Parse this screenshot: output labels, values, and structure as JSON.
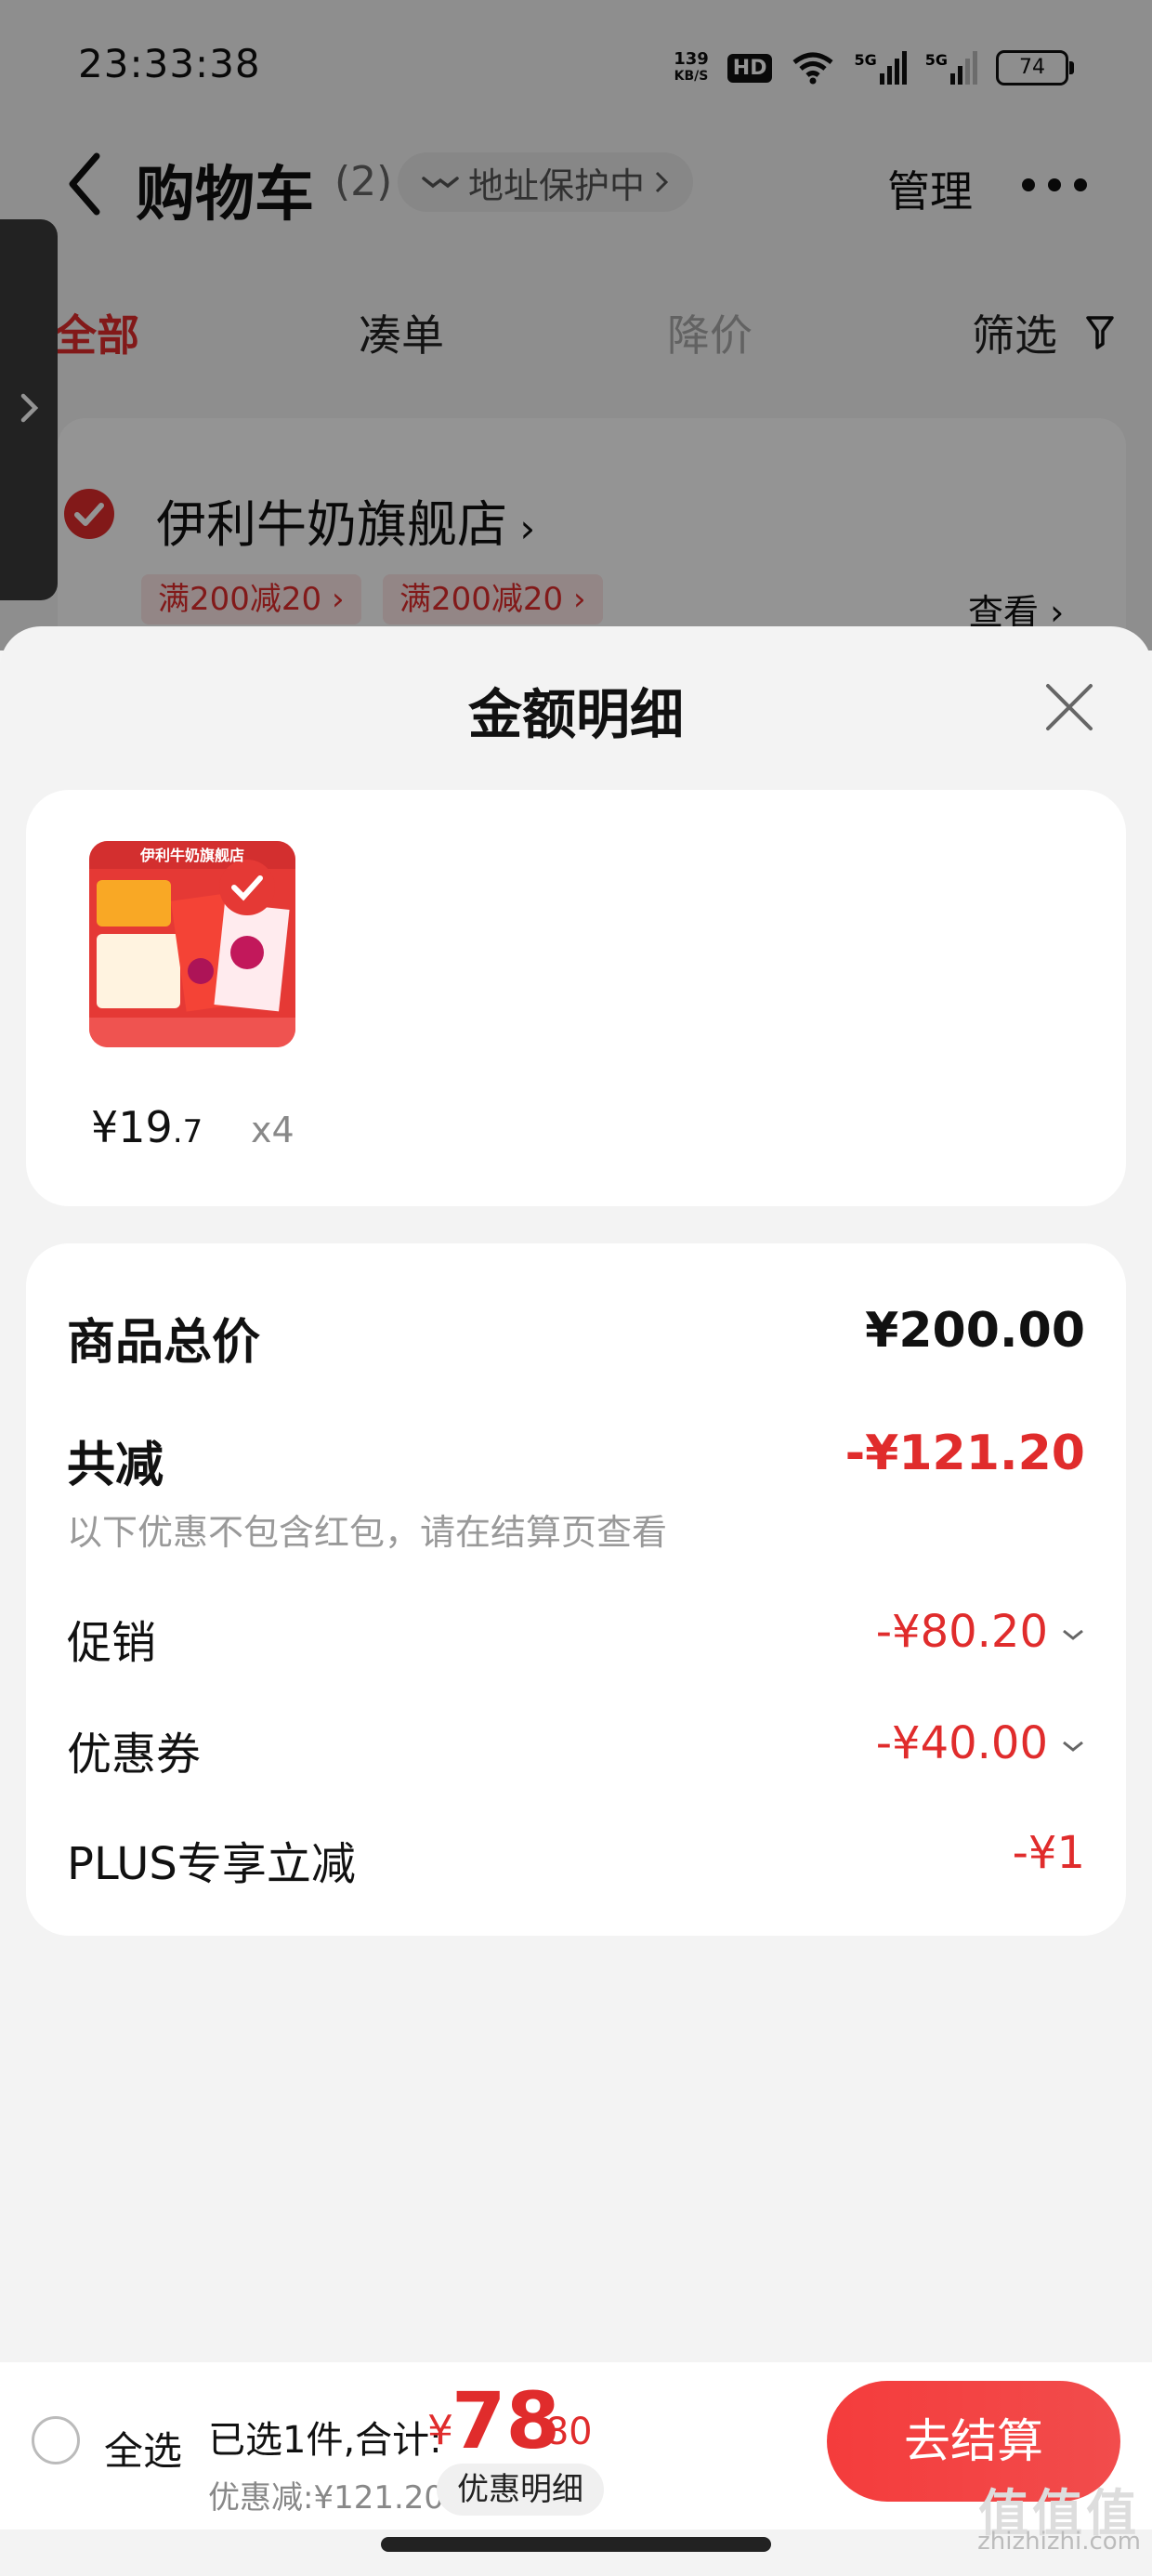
{
  "status_bar": {
    "time": "23:33:38",
    "net_speed_value": "139",
    "net_speed_unit": "KB/S",
    "hd_badge": "HD",
    "signal_1": "5G",
    "signal_2": "5G",
    "battery": "74"
  },
  "header": {
    "title": "购物车",
    "count": "(2)",
    "address_protection": "地址保护中",
    "manage": "管理"
  },
  "tabs": [
    "全部",
    "凑单",
    "降价",
    "筛选"
  ],
  "store": {
    "name": "伊利牛奶旗舰店",
    "promo_tags": [
      "满200减20",
      "满200减20"
    ],
    "see_more": "查看"
  },
  "sheet": {
    "title": "金额明细",
    "product": {
      "image_store_text": "伊利牛奶旗舰店",
      "price_yen": "¥",
      "price_int": "19",
      "price_dec": ".7",
      "quantity": "x4"
    },
    "details": {
      "total_label": "商品总价",
      "total_value": "¥200.00",
      "reduce_label": "共减",
      "reduce_value": "-¥121.20",
      "note": "以下优惠不包含红包，请在结算页查看",
      "promo_label": "促销",
      "promo_value": "-¥80.20",
      "coupon_label": "优惠券",
      "coupon_value": "-¥40.00",
      "plus_label": "PLUS专享立减",
      "plus_value": "-¥1"
    }
  },
  "bottom_bar": {
    "select_all": "全选",
    "summary": "已选1件,合计:",
    "total_yen": "¥",
    "total_int": "78",
    "total_dec": ".80",
    "discount": "优惠减:¥121.20",
    "detail_button": "优惠明细",
    "checkout": "去结算"
  },
  "watermark": {
    "text": "值值值",
    "domain": "zhizhizhi.com"
  },
  "colors": {
    "accent_red": "#e02c2c",
    "checkout_red": "#f43c3c"
  }
}
